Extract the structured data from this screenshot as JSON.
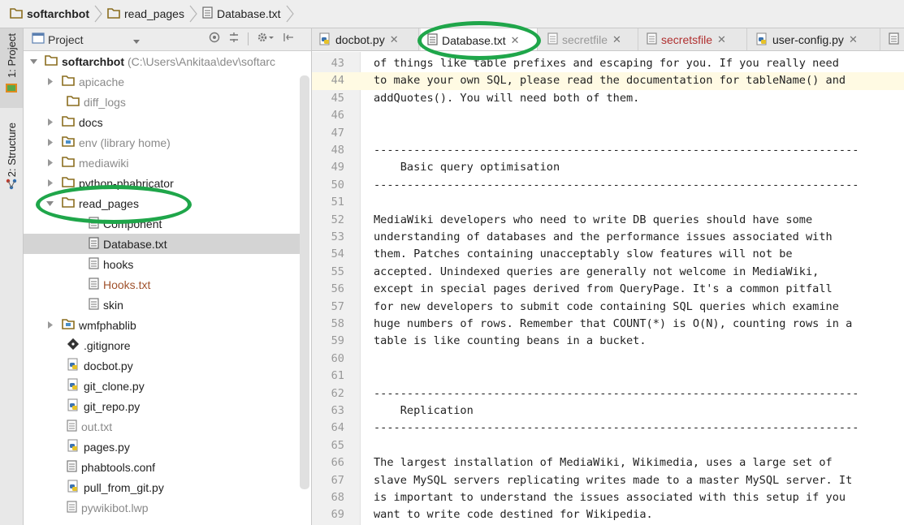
{
  "breadcrumb": {
    "items": [
      {
        "label": "softarchbot",
        "icon": "folder-icon"
      },
      {
        "label": "read_pages",
        "icon": "folder-icon"
      },
      {
        "label": "Database.txt",
        "icon": "text-file-icon"
      }
    ]
  },
  "toolstrip": {
    "tabs": [
      {
        "label": "1: Project"
      },
      {
        "label": "2: Structure"
      }
    ]
  },
  "project_panel": {
    "title": "Project",
    "root_label": "softarchbot",
    "root_path": "(C:\\Users\\Ankitaa\\dev\\softarc",
    "items": [
      {
        "label": "apicache",
        "kind": "folder"
      },
      {
        "label": "diff_logs",
        "kind": "folder"
      },
      {
        "label": "docs",
        "kind": "folder"
      },
      {
        "label": "env (library home)",
        "kind": "library-folder"
      },
      {
        "label": "mediawiki",
        "kind": "folder"
      },
      {
        "label": "python-phabricator",
        "kind": "folder"
      },
      {
        "label": "read_pages",
        "kind": "folder"
      },
      {
        "label": "Component",
        "kind": "text-file"
      },
      {
        "label": "Database.txt",
        "kind": "text-file"
      },
      {
        "label": "hooks",
        "kind": "text-file"
      },
      {
        "label": "Hooks.txt",
        "kind": "text-file"
      },
      {
        "label": "skin",
        "kind": "text-file"
      },
      {
        "label": "wmfphablib",
        "kind": "library-folder"
      },
      {
        "label": ".gitignore",
        "kind": "git-file"
      },
      {
        "label": "docbot.py",
        "kind": "python-file"
      },
      {
        "label": "git_clone.py",
        "kind": "python-file"
      },
      {
        "label": "git_repo.py",
        "kind": "python-file"
      },
      {
        "label": "out.txt",
        "kind": "text-file"
      },
      {
        "label": "pages.py",
        "kind": "python-file"
      },
      {
        "label": "phabtools.conf",
        "kind": "text-file"
      },
      {
        "label": "pull_from_git.py",
        "kind": "python-file"
      },
      {
        "label": "pywikibot.lwp",
        "kind": "text-file"
      }
    ]
  },
  "tabs": [
    {
      "label": "docbot.py",
      "icon": "python-file-icon"
    },
    {
      "label": "Database.txt",
      "icon": "text-file-icon"
    },
    {
      "label": "secretfile",
      "icon": "text-file-icon"
    },
    {
      "label": "secretsfile",
      "icon": "text-file-icon"
    },
    {
      "label": "user-config.py",
      "icon": "python-file-icon"
    }
  ],
  "editor": {
    "lines": [
      {
        "n": "43",
        "text": "of things like table prefixes and escaping for you. If you really need"
      },
      {
        "n": "44",
        "text": "to make your own SQL, please read the documentation for tableName() and"
      },
      {
        "n": "45",
        "text": "addQuotes(). You will need both of them."
      },
      {
        "n": "46",
        "text": ""
      },
      {
        "n": "47",
        "text": ""
      },
      {
        "n": "48",
        "text": "-------------------------------------------------------------------------"
      },
      {
        "n": "49",
        "text": "    Basic query optimisation"
      },
      {
        "n": "50",
        "text": "-------------------------------------------------------------------------"
      },
      {
        "n": "51",
        "text": ""
      },
      {
        "n": "52",
        "text": "MediaWiki developers who need to write DB queries should have some"
      },
      {
        "n": "53",
        "text": "understanding of databases and the performance issues associated with"
      },
      {
        "n": "54",
        "text": "them. Patches containing unacceptably slow features will not be"
      },
      {
        "n": "55",
        "text": "accepted. Unindexed queries are generally not welcome in MediaWiki,"
      },
      {
        "n": "56",
        "text": "except in special pages derived from QueryPage. It's a common pitfall"
      },
      {
        "n": "57",
        "text": "for new developers to submit code containing SQL queries which examine"
      },
      {
        "n": "58",
        "text": "huge numbers of rows. Remember that COUNT(*) is O(N), counting rows in a"
      },
      {
        "n": "59",
        "text": "table is like counting beans in a bucket."
      },
      {
        "n": "60",
        "text": ""
      },
      {
        "n": "61",
        "text": ""
      },
      {
        "n": "62",
        "text": "-------------------------------------------------------------------------"
      },
      {
        "n": "63",
        "text": "    Replication"
      },
      {
        "n": "64",
        "text": "-------------------------------------------------------------------------"
      },
      {
        "n": "65",
        "text": ""
      },
      {
        "n": "66",
        "text": "The largest installation of MediaWiki, Wikimedia, uses a large set of"
      },
      {
        "n": "67",
        "text": "slave MySQL servers replicating writes made to a master MySQL server. It"
      },
      {
        "n": "68",
        "text": "is important to understand the issues associated with this setup if you"
      },
      {
        "n": "69",
        "text": "want to write code destined for Wikipedia."
      }
    ]
  },
  "colors": {
    "annotation": "#1fa64a",
    "folder": "#b8860b",
    "current_line": "#fffae3"
  }
}
